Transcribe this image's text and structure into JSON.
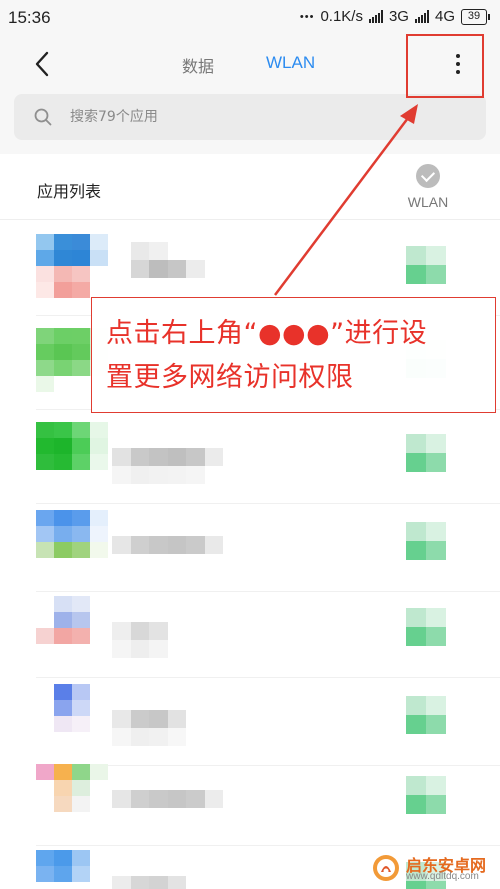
{
  "status_bar": {
    "time": "15:36",
    "dots": "•••",
    "speed": "0.1K/s",
    "network_3g": "3G",
    "network_4g": "4G",
    "battery": "39"
  },
  "header": {
    "tabs": [
      {
        "label": "数据",
        "active": false
      },
      {
        "label": "WLAN",
        "active": true
      }
    ],
    "accent_color": "#2d8cf0"
  },
  "search": {
    "placeholder": "搜索79个应用"
  },
  "list": {
    "title": "应用列表",
    "column_label": "WLAN",
    "apps": [
      {
        "icon": [
          [
            "#93c7ef",
            "#3a8fd9",
            "#3b8bd8",
            "#dcebf9"
          ],
          [
            "#5ea8e8",
            "#2f87d6",
            "#2d85d6",
            "#c9e0f6"
          ],
          [
            "#fbe1e0",
            "#f4b8b4",
            "#f6c5c2",
            "#ffffff"
          ],
          [
            "#fde8e6",
            "#f29f9a",
            "#f4aaa5",
            "#ffffff"
          ]
        ],
        "name": [
          [
            "#ffffff",
            "#e9e9e9",
            "#f0f0f0",
            "#ffffff",
            "#ffffff",
            "#ffffff",
            "#ffffff"
          ],
          [
            "#ffffff",
            "#d6d6d6",
            "#bdbdbd",
            "#c6c6c6",
            "#ececec",
            "#ffffff",
            "#ffffff"
          ],
          [
            "#ffffff",
            "#ffffff",
            "#ffffff",
            "#ffffff",
            "#ffffff",
            "#ffffff",
            "#ffffff"
          ]
        ],
        "wlan_on": true
      },
      {
        "icon": [
          [
            "#7fd47a",
            "#6ccf66",
            "#6dcf66",
            "#d6f2d4"
          ],
          [
            "#66cc5f",
            "#5ac653",
            "#63ca5c",
            "#d3f1d0"
          ],
          [
            "#8ed98a",
            "#79d373",
            "#8bd886",
            "#e2f6e0"
          ],
          [
            "#eaf8e8",
            "#ffffff",
            "#ffffff",
            "#ffffff"
          ]
        ],
        "name": [
          [
            "#ffffff",
            "#ffffff",
            "#ffffff",
            "#ffffff",
            "#ffffff",
            "#ffffff",
            "#ffffff"
          ],
          [
            "#ffffff",
            "#ffffff",
            "#ffffff",
            "#ffffff",
            "#ffffff",
            "#ffffff",
            "#ffffff"
          ],
          [
            "#ffffff",
            "#ffffff",
            "#ffffff",
            "#ffffff",
            "#ffffff",
            "#ffffff",
            "#ffffff"
          ]
        ],
        "wlan_on": true
      },
      {
        "icon": [
          [
            "#35c142",
            "#3ac548",
            "#6dd676",
            "#e6f7e7"
          ],
          [
            "#22b92f",
            "#1db52b",
            "#4ccc57",
            "#e0f5e2"
          ],
          [
            "#2fbd3c",
            "#26ba33",
            "#5dd167",
            "#eaf8eb"
          ],
          [
            "#ffffff",
            "#ffffff",
            "#ffffff",
            "#ffffff"
          ]
        ],
        "name": [
          [
            "#ffffff",
            "#ffffff",
            "#ffffff",
            "#ffffff",
            "#ffffff",
            "#ffffff",
            "#ffffff"
          ],
          [
            "#e2e2e2",
            "#c9c9c9",
            "#c3c3c3",
            "#bfbfbf",
            "#c7c7c7",
            "#ebebeb",
            "#ffffff"
          ],
          [
            "#f5f5f5",
            "#f0f0f0",
            "#f2f2f2",
            "#f3f3f3",
            "#f5f5f5",
            "#ffffff",
            "#ffffff"
          ]
        ],
        "wlan_on": true
      },
      {
        "icon": [
          [
            "#6aa6ef",
            "#4b93ea",
            "#5a9cec",
            "#e4effc"
          ],
          [
            "#a2c6f4",
            "#78aeee",
            "#8ab8f0",
            "#eef4fd"
          ],
          [
            "#c7e3b4",
            "#8ccb63",
            "#a0d37e",
            "#f2f9ec"
          ],
          [
            "#ffffff",
            "#ffffff",
            "#ffffff",
            "#ffffff"
          ]
        ],
        "name": [
          [
            "#ffffff",
            "#ffffff",
            "#ffffff",
            "#ffffff",
            "#ffffff",
            "#ffffff",
            "#ffffff"
          ],
          [
            "#e6e6e6",
            "#cfcfcf",
            "#c8c8c8",
            "#c5c5c5",
            "#cacaca",
            "#e9e9e9",
            "#ffffff"
          ],
          [
            "#ffffff",
            "#ffffff",
            "#ffffff",
            "#ffffff",
            "#ffffff",
            "#ffffff",
            "#ffffff"
          ]
        ],
        "wlan_on": true
      },
      {
        "icon": [
          [
            "#ffffff",
            "#d7e0f5",
            "#e2e8f7",
            "#ffffff"
          ],
          [
            "#ffffff",
            "#9eb2ea",
            "#b7c6ee",
            "#ffffff"
          ],
          [
            "#f6d2d1",
            "#f2a6a3",
            "#f3b1ae",
            "#ffffff"
          ],
          [
            "#ffffff",
            "#ffffff",
            "#ffffff",
            "#ffffff"
          ]
        ],
        "name": [
          [
            "#ffffff",
            "#ffffff",
            "#ffffff",
            "#ffffff",
            "#ffffff",
            "#ffffff",
            "#ffffff"
          ],
          [
            "#eeeeee",
            "#d8d8d8",
            "#e3e3e3",
            "#ffffff",
            "#ffffff",
            "#ffffff",
            "#ffffff"
          ],
          [
            "#f5f5f5",
            "#eeeeee",
            "#f4f4f4",
            "#ffffff",
            "#ffffff",
            "#ffffff",
            "#ffffff"
          ]
        ],
        "wlan_on": true
      },
      {
        "icon": [
          [
            "#ffffff",
            "#5a7fe8",
            "#b8c8f4",
            "#ffffff"
          ],
          [
            "#ffffff",
            "#8aa4ee",
            "#cdd8f7",
            "#ffffff"
          ],
          [
            "#ffffff",
            "#efe7f4",
            "#f6f0f8",
            "#ffffff"
          ],
          [
            "#ffffff",
            "#ffffff",
            "#ffffff",
            "#ffffff"
          ]
        ],
        "name": [
          [
            "#ffffff",
            "#ffffff",
            "#ffffff",
            "#ffffff",
            "#ffffff",
            "#ffffff",
            "#ffffff"
          ],
          [
            "#e8e8e8",
            "#cbcbcb",
            "#c7c7c7",
            "#e2e2e2",
            "#ffffff",
            "#ffffff",
            "#ffffff"
          ],
          [
            "#f6f6f6",
            "#efefef",
            "#f1f1f1",
            "#f7f7f7",
            "#ffffff",
            "#ffffff",
            "#ffffff"
          ]
        ],
        "wlan_on": true
      },
      {
        "icon": [
          [
            "#f0a7c9",
            "#f6b14e",
            "#8fd68a",
            "#eaf6e8"
          ],
          [
            "#ffffff",
            "#f8d5b0",
            "#ddeedd",
            "#ffffff"
          ],
          [
            "#ffffff",
            "#f6d9bf",
            "#f3f3f3",
            "#ffffff"
          ],
          [
            "#ffffff",
            "#ffffff",
            "#ffffff",
            "#ffffff"
          ]
        ],
        "name": [
          [
            "#ffffff",
            "#ffffff",
            "#ffffff",
            "#ffffff",
            "#ffffff",
            "#ffffff",
            "#ffffff"
          ],
          [
            "#e6e6e6",
            "#cfcfcf",
            "#c9c9c9",
            "#c6c6c6",
            "#cbcbcb",
            "#ececec",
            "#ffffff"
          ],
          [
            "#ffffff",
            "#ffffff",
            "#ffffff",
            "#ffffff",
            "#ffffff",
            "#ffffff",
            "#ffffff"
          ]
        ],
        "wlan_on": true
      },
      {
        "icon": [
          [
            "#5fa6ee",
            "#4b9aea",
            "#9cc6f3",
            "#ffffff"
          ],
          [
            "#7ab3f1",
            "#5ea5ed",
            "#b3d3f6",
            "#ffffff"
          ],
          [
            "#ffffff",
            "#ffffff",
            "#ffffff",
            "#ffffff"
          ],
          [
            "#ffffff",
            "#ffffff",
            "#ffffff",
            "#ffffff"
          ]
        ],
        "name": [
          [
            "#ffffff",
            "#ffffff",
            "#ffffff",
            "#ffffff",
            "#ffffff",
            "#ffffff",
            "#ffffff"
          ],
          [
            "#ececec",
            "#d7d7d7",
            "#d3d3d3",
            "#e3e3e3",
            "#ffffff",
            "#ffffff",
            "#ffffff"
          ],
          [
            "#ffffff",
            "#ffffff",
            "#ffffff",
            "#ffffff",
            "#ffffff",
            "#ffffff",
            "#ffffff"
          ]
        ],
        "wlan_on": true
      }
    ]
  },
  "annotation": {
    "line1": "点击右上角“●●●”进行设",
    "line2": "置更多网络访问权限",
    "color": "#e8322a"
  },
  "watermark": {
    "name": "启东安卓网",
    "url": "www.qdltdq.com"
  }
}
